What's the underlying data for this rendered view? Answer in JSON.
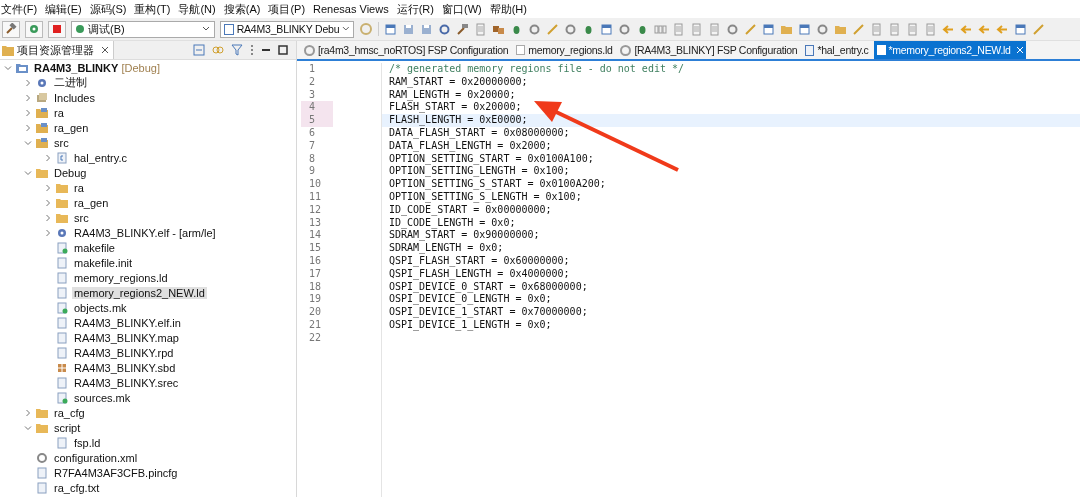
{
  "menu_bar": [
    "文件(F)",
    "编辑(E)",
    "源码(S)",
    "重构(T)",
    "导航(N)",
    "搜索(A)",
    "项目(P)",
    "Renesas Views",
    "运行(R)",
    "窗口(W)",
    "帮助(H)"
  ],
  "toolbar": {
    "launch_mode": "调试(B)",
    "launch_config": "RA4M3_BLINKY Debu"
  },
  "explorer": {
    "title": "项目资源管理器",
    "tree": [
      {
        "label": "RA4M3_BLINKY",
        "suffix": "[Debug]",
        "kind": "project",
        "expanded": true,
        "selected": false,
        "children": [
          {
            "label": "二进制",
            "kind": "binary",
            "expanded": false,
            "selected": false
          },
          {
            "label": "Includes",
            "kind": "includes",
            "expanded": false,
            "selected": false
          },
          {
            "label": "ra",
            "kind": "source-folder",
            "expanded": false,
            "selected": false
          },
          {
            "label": "ra_gen",
            "kind": "source-folder",
            "expanded": false,
            "selected": false
          },
          {
            "label": "src",
            "kind": "source-folder",
            "expanded": true,
            "selected": false,
            "children": [
              {
                "label": "hal_entry.c",
                "kind": "c-file",
                "expanded": false,
                "selected": false
              }
            ]
          },
          {
            "label": "Debug",
            "kind": "folder",
            "expanded": true,
            "selected": false,
            "children": [
              {
                "label": "ra",
                "kind": "folder",
                "expanded": false,
                "selected": false
              },
              {
                "label": "ra_gen",
                "kind": "folder",
                "expanded": false,
                "selected": false
              },
              {
                "label": "src",
                "kind": "folder",
                "expanded": false,
                "selected": false
              },
              {
                "label": "RA4M3_BLINKY.elf - [arm/le]",
                "kind": "binary",
                "expanded": false,
                "selected": false
              },
              {
                "label": "makefile",
                "kind": "makefile",
                "selected": false
              },
              {
                "label": "makefile.init",
                "kind": "file",
                "selected": false
              },
              {
                "label": "memory_regions.ld",
                "kind": "file",
                "selected": false
              },
              {
                "label": "memory_regions2_NEW.ld",
                "kind": "file",
                "selected": true
              },
              {
                "label": "objects.mk",
                "kind": "makefile",
                "selected": false
              },
              {
                "label": "RA4M3_BLINKY.elf.in",
                "kind": "file",
                "selected": false
              },
              {
                "label": "RA4M3_BLINKY.map",
                "kind": "file",
                "selected": false
              },
              {
                "label": "RA4M3_BLINKY.rpd",
                "kind": "file",
                "selected": false
              },
              {
                "label": "RA4M3_BLINKY.sbd",
                "kind": "grid-file",
                "selected": false
              },
              {
                "label": "RA4M3_BLINKY.srec",
                "kind": "file",
                "selected": false
              },
              {
                "label": "sources.mk",
                "kind": "makefile",
                "selected": false
              }
            ]
          },
          {
            "label": "ra_cfg",
            "kind": "folder",
            "expanded": false,
            "selected": false
          },
          {
            "label": "script",
            "kind": "folder",
            "expanded": true,
            "selected": false,
            "children": [
              {
                "label": "fsp.ld",
                "kind": "file",
                "selected": false
              }
            ]
          },
          {
            "label": "configuration.xml",
            "kind": "config",
            "selected": false
          },
          {
            "label": "R7FA4M3AF3CFB.pincfg",
            "kind": "file",
            "selected": false
          },
          {
            "label": "ra_cfg.txt",
            "kind": "file",
            "selected": false
          }
        ]
      }
    ]
  },
  "editor_tabs": [
    {
      "label": "[ra4m3_hmsc_noRTOS] FSP Configuration",
      "kind": "config",
      "selected": false
    },
    {
      "label": "memory_regions.ld",
      "kind": "file",
      "selected": false
    },
    {
      "label": "[RA4M3_BLINKY] FSP Configuration",
      "kind": "config",
      "selected": false
    },
    {
      "label": "*hal_entry.c",
      "kind": "c-file",
      "selected": false
    },
    {
      "label": "*memory_regions2_NEW.ld",
      "kind": "file",
      "selected": true
    }
  ],
  "code_lines": [
    {
      "number": "1",
      "text": "/* generated memory regions file - do not edit */",
      "kind": "comment",
      "changed": false,
      "current": false
    },
    {
      "number": "2",
      "text": "RAM_START = 0x20000000;",
      "kind": "code",
      "changed": false,
      "current": false
    },
    {
      "number": "3",
      "text": "RAM_LENGTH = 0x20000;",
      "kind": "code",
      "changed": false,
      "current": false
    },
    {
      "number": "4",
      "text": "FLASH_START = 0x20000;",
      "kind": "code",
      "changed": true,
      "current": false
    },
    {
      "number": "5",
      "text": "FLASH_LENGTH = 0xE0000;",
      "kind": "code",
      "changed": true,
      "current": true
    },
    {
      "number": "6",
      "text": "DATA_FLASH_START = 0x08000000;",
      "kind": "code",
      "changed": false,
      "current": false
    },
    {
      "number": "7",
      "text": "DATA_FLASH_LENGTH = 0x2000;",
      "kind": "code",
      "changed": false,
      "current": false
    },
    {
      "number": "8",
      "text": "OPTION_SETTING_START = 0x0100A100;",
      "kind": "code",
      "changed": false,
      "current": false
    },
    {
      "number": "9",
      "text": "OPTION_SETTING_LENGTH = 0x100;",
      "kind": "code",
      "changed": false,
      "current": false
    },
    {
      "number": "10",
      "text": "OPTION_SETTING_S_START = 0x0100A200;",
      "kind": "code",
      "changed": false,
      "current": false
    },
    {
      "number": "11",
      "text": "OPTION_SETTING_S_LENGTH = 0x100;",
      "kind": "code",
      "changed": false,
      "current": false
    },
    {
      "number": "12",
      "text": "ID_CODE_START = 0x00000000;",
      "kind": "code",
      "changed": false,
      "current": false
    },
    {
      "number": "13",
      "text": "ID_CODE_LENGTH = 0x0;",
      "kind": "code",
      "changed": false,
      "current": false
    },
    {
      "number": "14",
      "text": "SDRAM_START = 0x90000000;",
      "kind": "code",
      "changed": false,
      "current": false
    },
    {
      "number": "15",
      "text": "SDRAM_LENGTH = 0x0;",
      "kind": "code",
      "changed": false,
      "current": false
    },
    {
      "number": "16",
      "text": "QSPI_FLASH_START = 0x60000000;",
      "kind": "code",
      "changed": false,
      "current": false
    },
    {
      "number": "17",
      "text": "QSPI_FLASH_LENGTH = 0x4000000;",
      "kind": "code",
      "changed": false,
      "current": false
    },
    {
      "number": "18",
      "text": "OSPI_DEVICE_0_START = 0x68000000;",
      "kind": "code",
      "changed": false,
      "current": false
    },
    {
      "number": "19",
      "text": "OSPI_DEVICE_0_LENGTH = 0x0;",
      "kind": "code",
      "changed": false,
      "current": false
    },
    {
      "number": "20",
      "text": "OSPI_DEVICE_1_START = 0x70000000;",
      "kind": "code",
      "changed": false,
      "current": false
    },
    {
      "number": "21",
      "text": "OSPI_DEVICE_1_LENGTH = 0x0;",
      "kind": "code",
      "changed": false,
      "current": false
    },
    {
      "number": "22",
      "kind": "code",
      "changed": false,
      "current": false
    }
  ]
}
